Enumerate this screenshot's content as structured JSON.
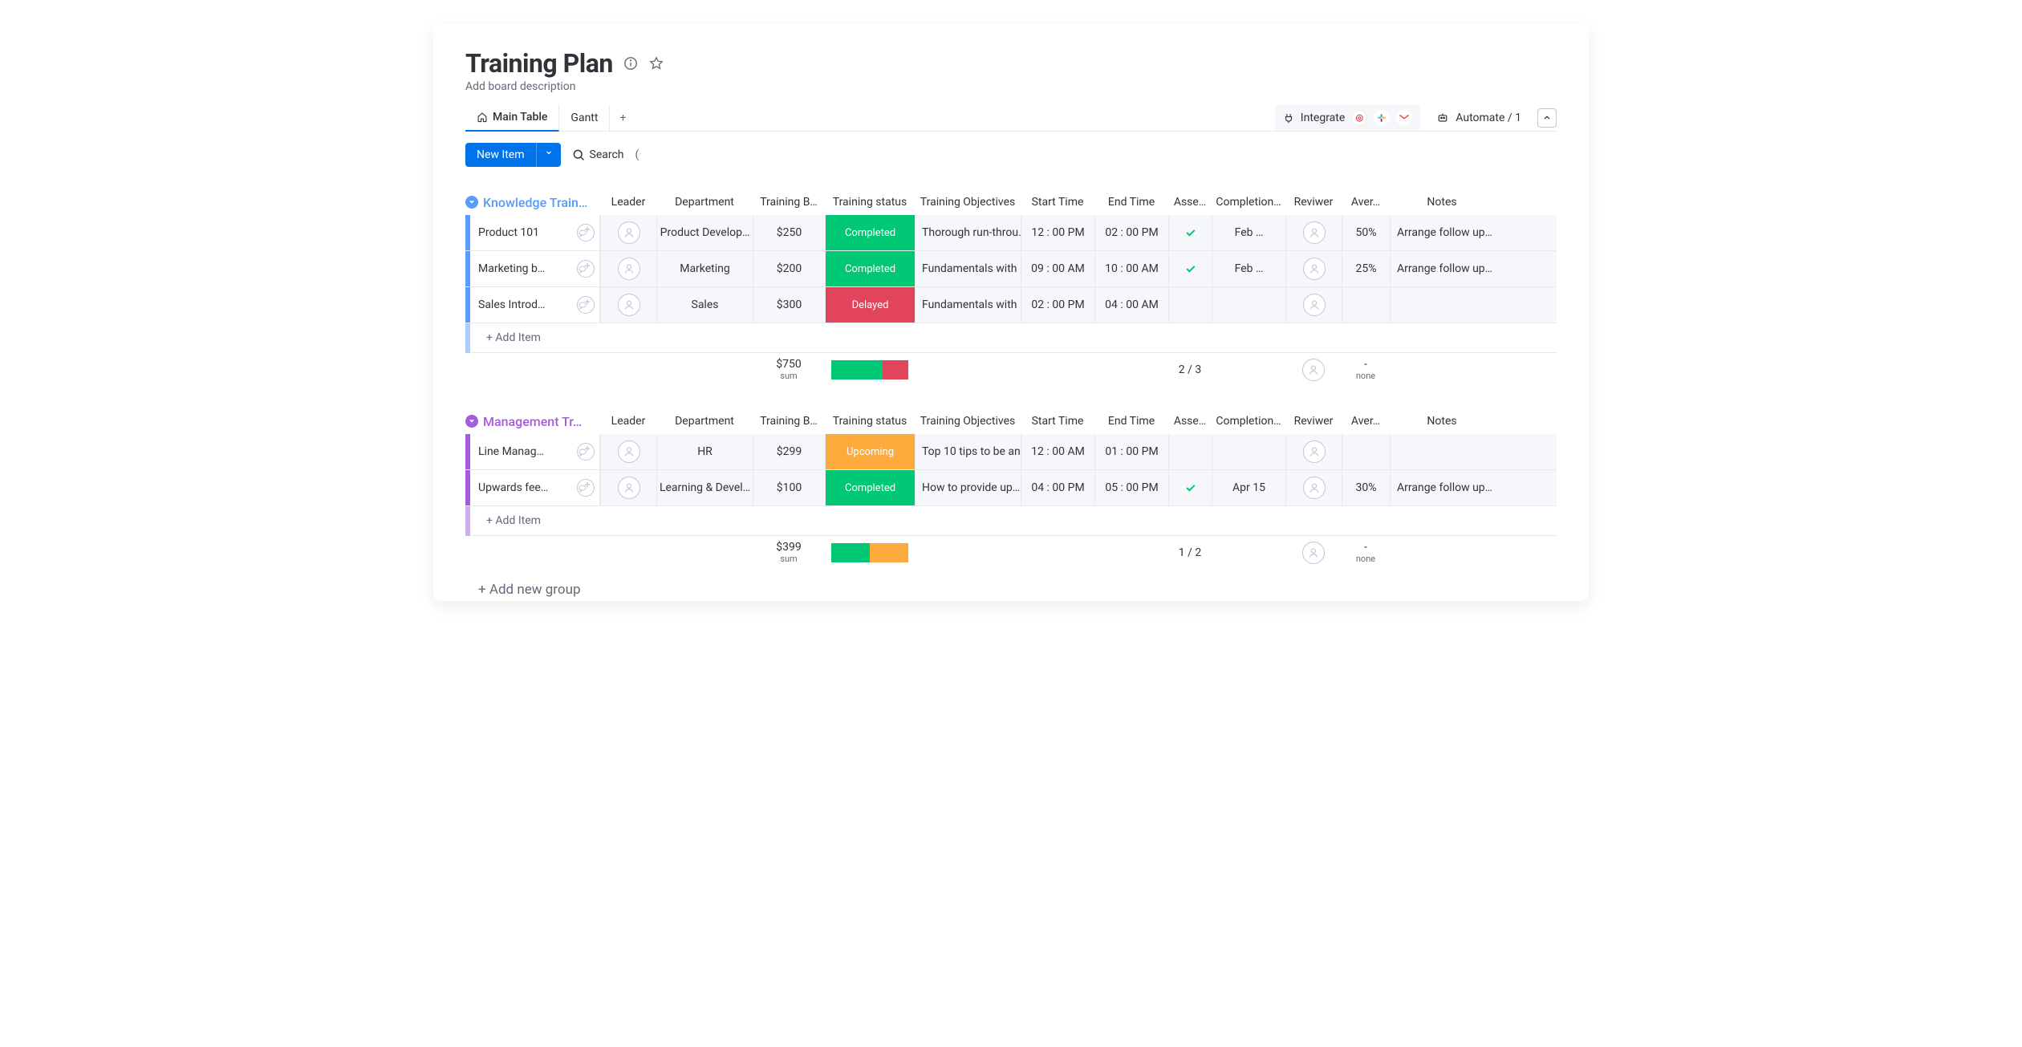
{
  "header": {
    "title": "Training Plan",
    "description": "Add board description"
  },
  "tabs": {
    "main": "Main Table",
    "gantt": "Gantt"
  },
  "topbar": {
    "integrate": "Integrate",
    "automate": "Automate / 1"
  },
  "toolbar": {
    "new_item": "New Item",
    "search": "Search"
  },
  "columns": {
    "leader": "Leader",
    "department": "Department",
    "budget": "Training B…",
    "status": "Training status",
    "objectives": "Training Objectives",
    "start": "Start Time",
    "end": "End Time",
    "assess": "Asse…",
    "completion": "Completion…",
    "reviewer": "Reviwer",
    "average": "Aver…",
    "notes": "Notes"
  },
  "groups": [
    {
      "title": "Knowledge Train…",
      "color": "#579bfc",
      "titleColor": "#579bfc",
      "rows": [
        {
          "name": "Product 101",
          "department": "Product Develop…",
          "budget": "$250",
          "status": "Completed",
          "statusColor": "#00c875",
          "objectives": "Thorough run-throu…",
          "start": "12 : 00 PM",
          "end": "02 : 00 PM",
          "assess": true,
          "completion": "Feb …",
          "average": "50%",
          "notes": "Arrange follow up…"
        },
        {
          "name": "Marketing b…",
          "department": "Marketing",
          "budget": "$200",
          "status": "Completed",
          "statusColor": "#00c875",
          "objectives": "Fundamentals with …",
          "start": "09 : 00 AM",
          "end": "10 : 00 AM",
          "assess": true,
          "completion": "Feb …",
          "average": "25%",
          "notes": "Arrange follow up…"
        },
        {
          "name": "Sales Introd…",
          "department": "Sales",
          "budget": "$300",
          "status": "Delayed",
          "statusColor": "#e2445c",
          "objectives": "Fundamentals with …",
          "start": "02 : 00 PM",
          "end": "04 : 00 AM",
          "assess": false,
          "completion": "",
          "average": "",
          "notes": ""
        }
      ],
      "addItem": "+ Add Item",
      "summary": {
        "budget": "$750",
        "budgetLabel": "sum",
        "statusSegments": [
          {
            "color": "#00c875",
            "pct": 66.7
          },
          {
            "color": "#e2445c",
            "pct": 33.3
          }
        ],
        "assess": "2 / 3",
        "average": "-",
        "averageLabel": "none"
      }
    },
    {
      "title": "Management Tr…",
      "color": "#a25ddc",
      "titleColor": "#a25ddc",
      "rows": [
        {
          "name": "Line Manag…",
          "department": "HR",
          "budget": "$299",
          "status": "Upcoming",
          "statusColor": "#fdab3d",
          "objectives": "Top 10 tips to be an…",
          "start": "12 : 00 AM",
          "end": "01 : 00 PM",
          "assess": false,
          "completion": "",
          "average": "",
          "notes": ""
        },
        {
          "name": "Upwards fee…",
          "department": "Learning & Devel…",
          "budget": "$100",
          "status": "Completed",
          "statusColor": "#00c875",
          "objectives": "How to provide up…",
          "start": "04 : 00 PM",
          "end": "05 : 00 PM",
          "assess": true,
          "completion": "Apr 15",
          "average": "30%",
          "notes": "Arrange follow up…"
        }
      ],
      "addItem": "+ Add Item",
      "summary": {
        "budget": "$399",
        "budgetLabel": "sum",
        "statusSegments": [
          {
            "color": "#00c875",
            "pct": 50
          },
          {
            "color": "#fdab3d",
            "pct": 50
          }
        ],
        "assess": "1 / 2",
        "average": "-",
        "averageLabel": "none"
      }
    }
  ],
  "addGroup": "+ Add new group"
}
